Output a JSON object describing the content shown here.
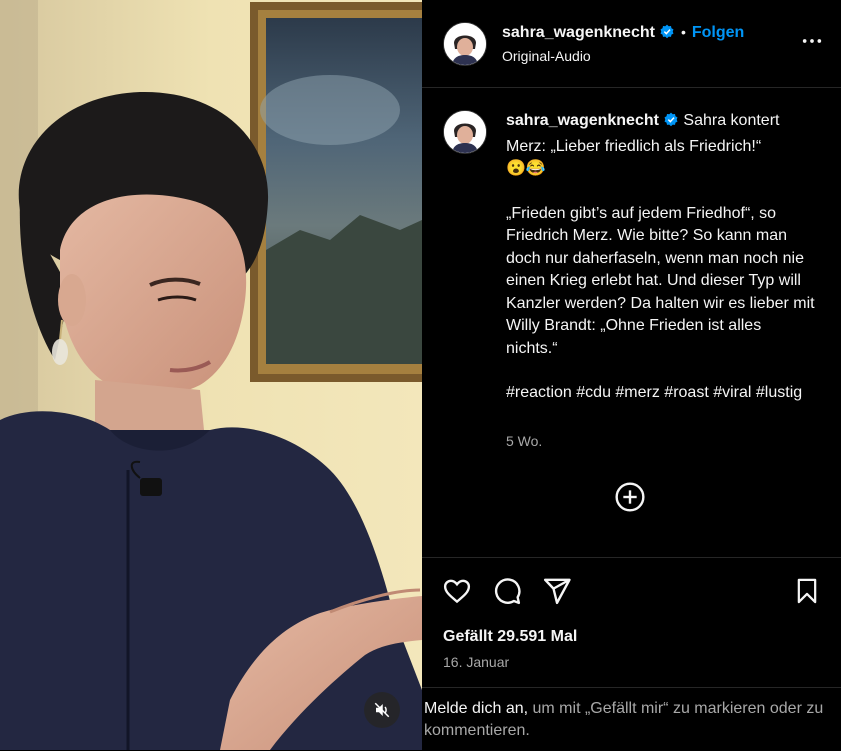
{
  "header": {
    "username": "sahra_wagenknecht",
    "separator": "•",
    "follow_label": "Folgen",
    "audio_label": "Original-Audio"
  },
  "caption": {
    "username": "sahra_wagenknecht",
    "line1": "Sahra kontert Merz: „Lieber friedlich als Friedrich!“",
    "emojis": "😮😂",
    "body": "„Frieden gibt’s auf jedem Friedhof“, so Friedrich Merz. Wie bitte? So kann man doch nur daherfaseln, wenn man noch nie einen Krieg erlebt hat. Und dieser Typ will Kanzler werden? Da halten wir es lieber mit Willy Brandt: „Ohne Frieden ist alles nichts.“",
    "hashtags": "#reaction #cdu #merz #roast #viral #lustig",
    "time": "5 Wo."
  },
  "actions": {
    "likes": "Gefällt 29.591 Mal",
    "date": "16. Januar"
  },
  "login_prompt": {
    "link": "Melde dich an,",
    "text": " um mit „Gefällt mir“ zu markieren oder zu kommentieren."
  },
  "icons": {
    "verified": "verified-badge-icon",
    "more": "more-options-icon",
    "add_comment": "plus-circle-icon",
    "like": "heart-icon",
    "comment": "comment-bubble-icon",
    "share": "send-icon",
    "save": "bookmark-icon",
    "mute": "speaker-muted-icon"
  },
  "colors": {
    "background": "#000000",
    "accent": "#0095f6",
    "secondary_text": "#a8a8a8",
    "divider": "#262626"
  }
}
